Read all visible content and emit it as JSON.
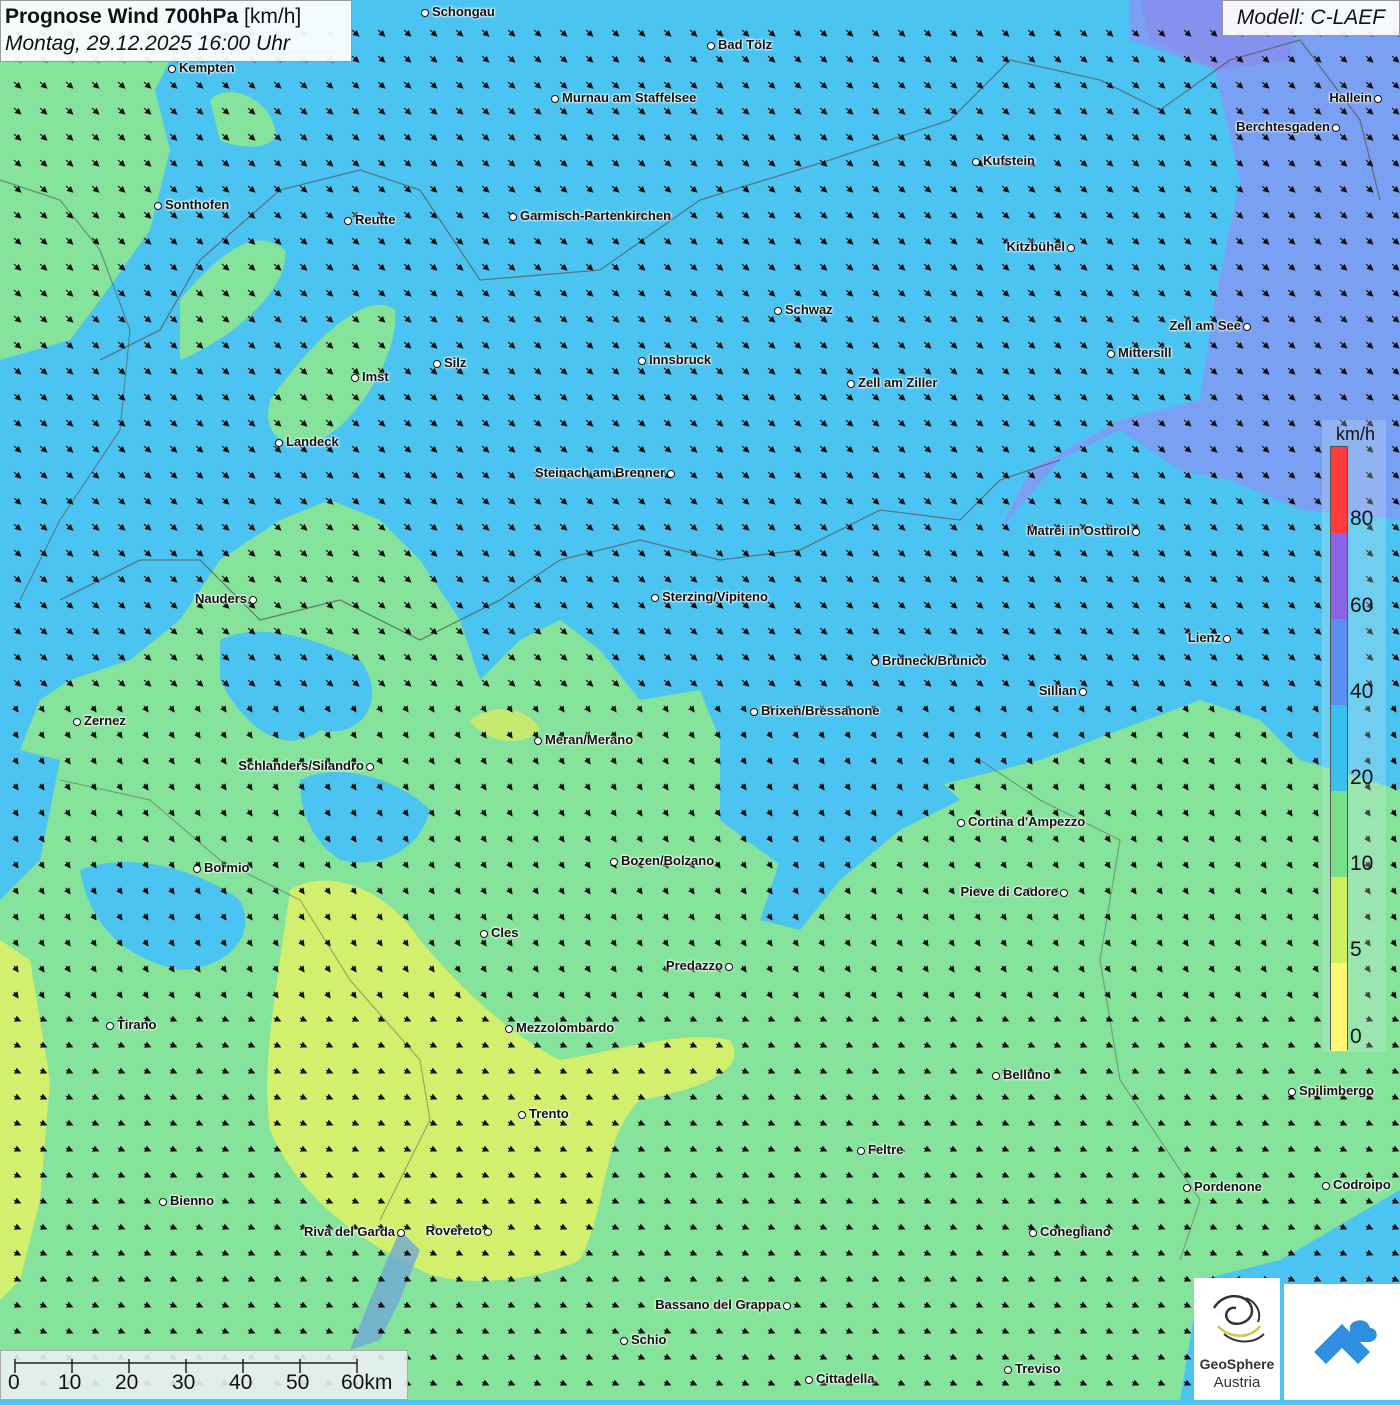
{
  "header": {
    "title": "Prognose Wind 700hPa",
    "unit": "[km/h]",
    "datetime": "Montag, 29.12.2025 16:00 Uhr",
    "model": "Modell: C-LAEF"
  },
  "legend": {
    "unit": "km/h",
    "labels": [
      "80",
      "60",
      "40",
      "20",
      "10",
      "5",
      "0"
    ],
    "colors": [
      "#ff3b3b",
      "#8c63e6",
      "#5b8ef0",
      "#38c0ee",
      "#78e08a",
      "#cdf060",
      "#fff870"
    ]
  },
  "scale": {
    "labels": [
      "0",
      "10",
      "20",
      "30",
      "40",
      "50",
      "60km"
    ]
  },
  "cities": [
    {
      "name": "Schongau"
    },
    {
      "name": "Bad Tölz"
    },
    {
      "name": "Kempten"
    },
    {
      "name": "Murnau am Staffelsee"
    },
    {
      "name": "Hallein"
    },
    {
      "name": "Berchtesgaden"
    },
    {
      "name": "Kufstein"
    },
    {
      "name": "Sonthofen"
    },
    {
      "name": "Reutte"
    },
    {
      "name": "Garmisch-Partenkirchen"
    },
    {
      "name": "Kitzbühel"
    },
    {
      "name": "Schwaz"
    },
    {
      "name": "Zell am See"
    },
    {
      "name": "Mittersill"
    },
    {
      "name": "Innsbruck"
    },
    {
      "name": "Silz"
    },
    {
      "name": "Imst"
    },
    {
      "name": "Zell am Ziller"
    },
    {
      "name": "Landeck"
    },
    {
      "name": "Steinach am Brenner"
    },
    {
      "name": "Matrei in Osttirol"
    },
    {
      "name": "Nauders"
    },
    {
      "name": "Sterzing/Vipiteno"
    },
    {
      "name": "Lienz"
    },
    {
      "name": "Bruneck/Brunico"
    },
    {
      "name": "Sillian"
    },
    {
      "name": "Brixen/Bressanone"
    },
    {
      "name": "Zernez"
    },
    {
      "name": "Meran/Merano"
    },
    {
      "name": "Schlanders/Silandro"
    },
    {
      "name": "Cortina d'Ampezzo"
    },
    {
      "name": "Bozen/Bolzano"
    },
    {
      "name": "Bormio"
    },
    {
      "name": "Pieve di Cadore"
    },
    {
      "name": "Cles"
    },
    {
      "name": "Predazzo"
    },
    {
      "name": "Tirano"
    },
    {
      "name": "Mezzolombardo"
    },
    {
      "name": "Belluno"
    },
    {
      "name": "Spilimbergo"
    },
    {
      "name": "Trento"
    },
    {
      "name": "Feltre"
    },
    {
      "name": "Pordenone"
    },
    {
      "name": "Codroipo"
    },
    {
      "name": "Bienno"
    },
    {
      "name": "Riva del Garda"
    },
    {
      "name": "Rovereto"
    },
    {
      "name": "Conegliano"
    },
    {
      "name": "Bassano del Grappa"
    },
    {
      "name": "Schio"
    },
    {
      "name": "Treviso"
    },
    {
      "name": "Cittadella"
    }
  ],
  "logos": {
    "geosphere_line1": "GeoSphere",
    "geosphere_line2": "Austria"
  }
}
